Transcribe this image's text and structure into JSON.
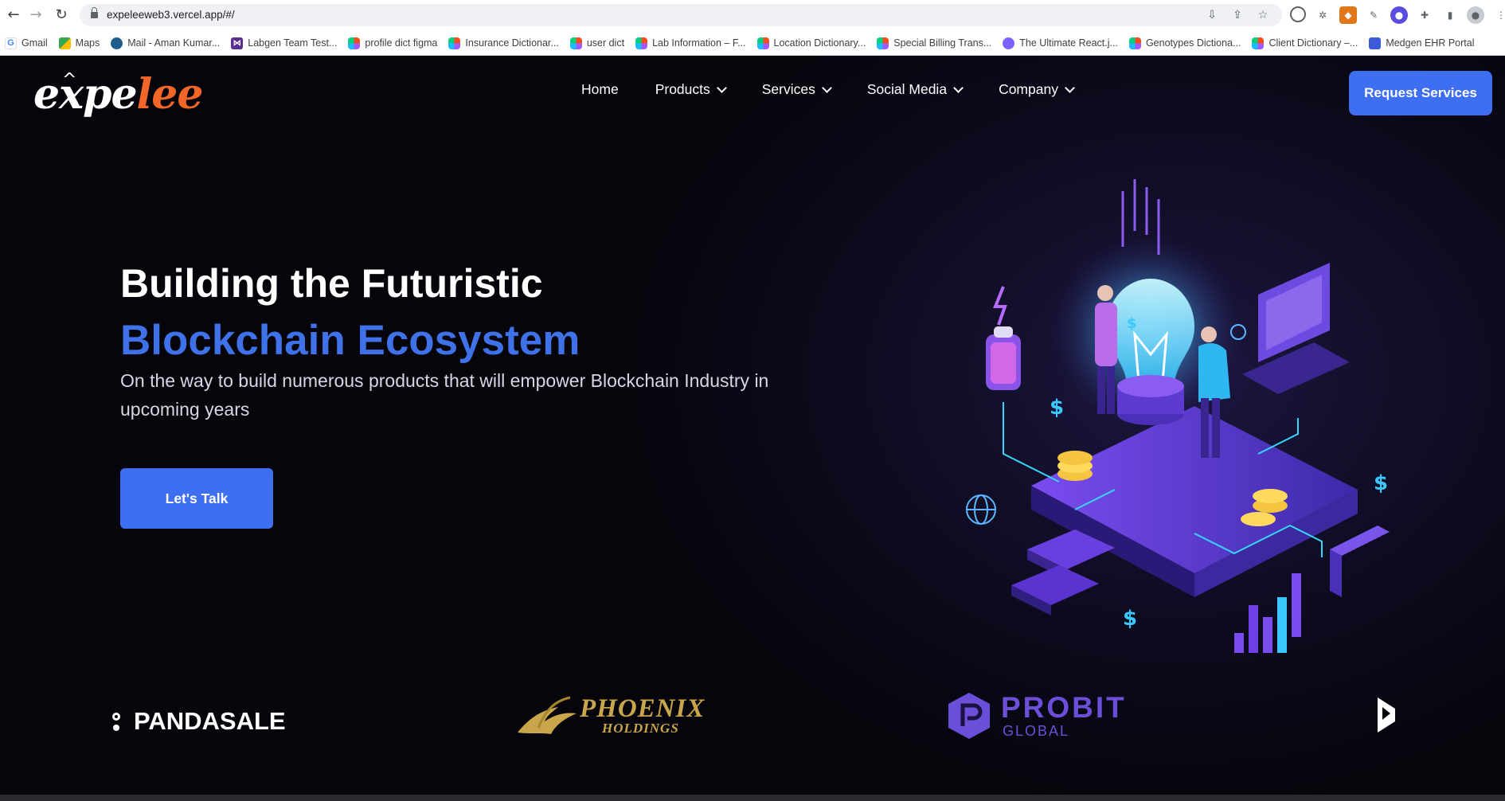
{
  "browser": {
    "url": "expeleeweb3.vercel.app/#/",
    "bookmarks": [
      {
        "label": "Gmail",
        "icon": "gmail-icon"
      },
      {
        "label": "Maps",
        "icon": "maps-icon"
      },
      {
        "label": "Mail - Aman Kumar...",
        "icon": "mail-icon"
      },
      {
        "label": "Labgen Team Test...",
        "icon": "visual-studio-icon"
      },
      {
        "label": "profile dict figma",
        "icon": "figma-icon"
      },
      {
        "label": "Insurance Dictionar...",
        "icon": "figma-icon"
      },
      {
        "label": "user dict",
        "icon": "figma-icon"
      },
      {
        "label": "Lab Information – F...",
        "icon": "figma-icon"
      },
      {
        "label": "Location Dictionary...",
        "icon": "figma-icon"
      },
      {
        "label": "Special Billing Trans...",
        "icon": "figma-icon"
      },
      {
        "label": "The Ultimate React.j...",
        "icon": "react-icon"
      },
      {
        "label": "Genotypes Dictiona...",
        "icon": "figma-icon"
      },
      {
        "label": "Client Dictionary –...",
        "icon": "figma-icon"
      },
      {
        "label": "Medgen EHR Portal",
        "icon": "medgen-icon"
      }
    ]
  },
  "site": {
    "logo_part1": "expe",
    "logo_part2": "lee",
    "nav": {
      "home": "Home",
      "products": "Products",
      "services": "Services",
      "social": "Social Media",
      "company": "Company"
    },
    "request_button": "Request Services",
    "hero": {
      "title_line1": "Building the Futuristic",
      "title_line2": "Blockchain Ecosystem",
      "subtitle": "On the way to build numerous products that will empower Blockchain Industry in upcoming years",
      "cta": "Let's Talk"
    },
    "partners": {
      "panda": "PANDASALE",
      "phoenix_name": "PHOENIX",
      "phoenix_sub": "HOLDINGS",
      "probit_name": "PROBIT",
      "probit_sub": "GLOBAL"
    }
  },
  "colors": {
    "accent_blue": "#3e6ff0",
    "logo_orange": "#f3662a",
    "phoenix_gold": "#c9a64b",
    "probit_purple": "#6b4fd9"
  }
}
